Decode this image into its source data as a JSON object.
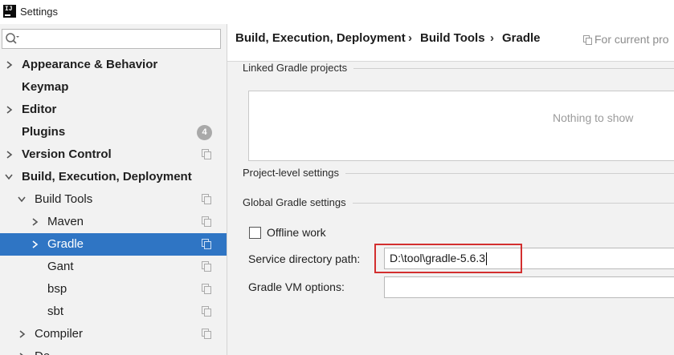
{
  "window": {
    "title": "Settings"
  },
  "search": {
    "value": "",
    "placeholder": ""
  },
  "sidebar": {
    "items": [
      {
        "label": "Appearance & Behavior"
      },
      {
        "label": "Keymap"
      },
      {
        "label": "Editor"
      },
      {
        "label": "Plugins",
        "badge": "4"
      },
      {
        "label": "Version Control"
      },
      {
        "label": "Build, Execution, Deployment"
      },
      {
        "label": "Build Tools"
      },
      {
        "label": "Maven"
      },
      {
        "label": "Gradle"
      },
      {
        "label": "Gant"
      },
      {
        "label": "bsp"
      },
      {
        "label": "sbt"
      },
      {
        "label": "Compiler"
      },
      {
        "label": "De"
      }
    ],
    "selected": "Gradle",
    "selection_color": "#2f75c4"
  },
  "breadcrumb": {
    "items": [
      "Build, Execution, Deployment",
      "Build Tools",
      "Gradle"
    ],
    "separator": "›"
  },
  "scope": {
    "label": "For current pro"
  },
  "sections": {
    "linked_projects": "Linked Gradle projects",
    "project_level": "Project-level settings",
    "global": "Global Gradle settings"
  },
  "linked_projects_panel": {
    "empty_text": "Nothing to show"
  },
  "offline_work": {
    "label": "Offline work",
    "checked": false
  },
  "service_directory": {
    "label": "Service directory path:",
    "value": "D:\\tool\\gradle-5.6.3"
  },
  "vm_options": {
    "label": "Gradle VM options:",
    "value": ""
  },
  "colors": {
    "highlight": "#d32f2f"
  }
}
